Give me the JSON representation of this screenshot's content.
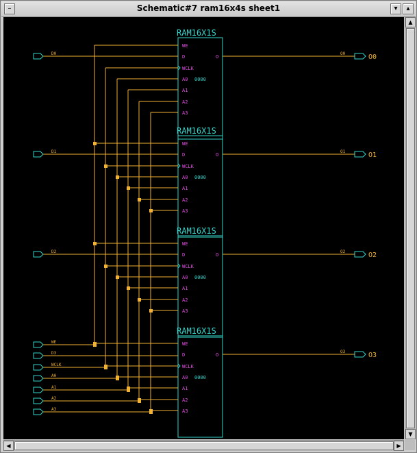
{
  "window": {
    "title": "Schematic#7 ram16x4s sheet1"
  },
  "colors": {
    "canvas": "#000000",
    "wire": "#f2b233",
    "symbol": "#33d6cc",
    "pin": "#e64ce6",
    "label": "#f2b233"
  },
  "instances": [
    {
      "name": "RAM16X1S",
      "init": "0000"
    },
    {
      "name": "RAM16X1S",
      "init": "0000"
    },
    {
      "name": "RAM16X1S",
      "init": "0000"
    },
    {
      "name": "RAM16X1S",
      "init": "0000"
    }
  ],
  "pins": [
    "WE",
    "D",
    "WCLK",
    "A0",
    "A1",
    "A2",
    "A3"
  ],
  "out_pin": "O",
  "data_inputs": [
    "D0",
    "D1",
    "D2",
    "D3"
  ],
  "data_outputs": [
    "O0",
    "O1",
    "O2",
    "O3"
  ],
  "out_net_labels": [
    "O0",
    "O1",
    "O2",
    "O3"
  ],
  "shared_inputs": [
    "WE",
    "D3",
    "WCLK",
    "A0",
    "A1",
    "A2",
    "A3"
  ]
}
